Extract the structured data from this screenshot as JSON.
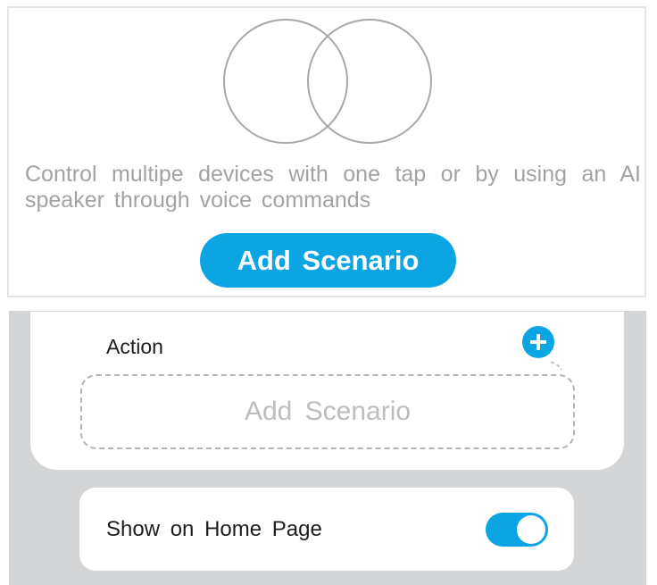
{
  "empty_state": {
    "description": "Control multipe devices with one tap or by using an AI speaker through voice commands",
    "add_button_label": "Add Scenario"
  },
  "action_section": {
    "label": "Action",
    "add_icon": "plus-circle-icon",
    "placeholder": "Add Scenario"
  },
  "home_option": {
    "label": "Show on Home Page",
    "toggle_on": true
  },
  "colors": {
    "accent": "#0ba5e4",
    "panel_grey": "#d4d5d6",
    "muted_text": "#a3a3a3"
  }
}
